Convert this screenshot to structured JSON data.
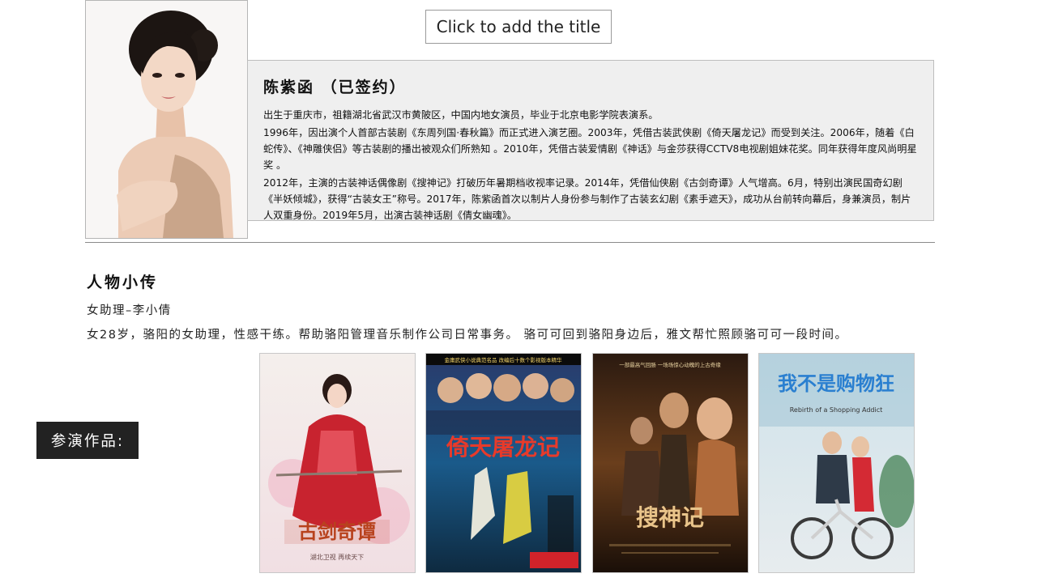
{
  "slide": {
    "title_placeholder": "Click to add the title"
  },
  "profile": {
    "name": "陈紫函 （已签约）",
    "paragraphs": [
      "出生于重庆市，祖籍湖北省武汉市黄陂区，中国内地女演员，毕业于北京电影学院表演系。",
      "1996年，因出演个人首部古装剧《东周列国·春秋篇》而正式进入演艺圈。2003年，凭借古装武侠剧《倚天屠龙记》而受到关注。2006年，随着《白蛇传》、《神雕侠侣》等古装剧的播出被观众们所熟知 。2010年，凭借古装爱情剧《神话》与金莎获得CCTV8电视剧姐妹花奖。同年获得年度风尚明星奖 。",
      "2012年，主演的古装神话偶像剧《搜神记》打破历年暑期档收视率记录。2014年，凭借仙侠剧《古剑奇谭》人气增高。6月，特别出演民国奇幻剧《半妖倾城》，获得“古装女王”称号。2017年，陈紫函首次以制片人身份参与制作了古装玄幻剧《素手遮天》，成功从台前转向幕后，身兼演员，制片人双重身份。2019年5月，出演古装神话剧《倩女幽魂》。"
    ]
  },
  "character": {
    "section_title": "人物小传",
    "role": "女助理–李小倩",
    "description": "女28岁，骆阳的女助理，性感干练。帮助骆阳管理音乐制作公司日常事务。 骆可可回到骆阳身边后，雅文帮忙照顾骆可可一段时间。"
  },
  "works": {
    "label": "参演作品:",
    "posters": [
      {
        "title": "古剑奇谭",
        "caption": "湖北卫视  再续天下"
      },
      {
        "title": "倚天屠龙记",
        "banner": "金庸武侠小说典范名品  改编后十数个影视版本精华"
      },
      {
        "title": "搜神记",
        "banner": "一部最高气回肠  一场场惊心动魄的上古奇缘"
      },
      {
        "title": "我不是购物狂",
        "subtitle": "Rebirth of a Shopping Addict"
      }
    ]
  }
}
